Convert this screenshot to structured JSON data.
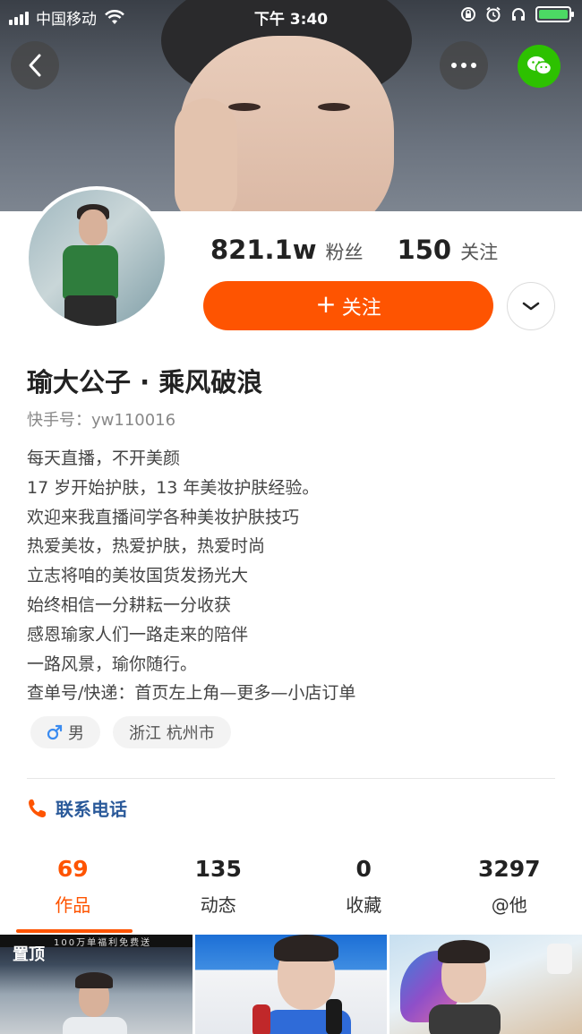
{
  "status_bar": {
    "carrier": "中国移动",
    "time": "下午 3:40"
  },
  "header": {
    "back_icon": "chevron-left-icon",
    "more_icon": "more-dots-icon",
    "share_icon": "wechat-icon"
  },
  "profile": {
    "followers_count": "821.1w",
    "followers_label": "粉丝",
    "following_count": "150",
    "following_label": "关注",
    "follow_button_label": "关注",
    "name": "瑜大公子 · 乘风破浪",
    "kuaishou_id": "快手号：yw110016",
    "bio_lines": [
      "每天直播，不开美颜",
      "17 岁开始护肤，13 年美妆护肤经验。",
      "欢迎来我直播间学各种美妆护肤技巧",
      "热爱美妆，热爱护肤，热爱时尚",
      "立志将咱的美妆国货发扬光大",
      "始终相信一分耕耘一分收获",
      "感恩瑜家人们一路走来的陪伴",
      "一路风景，瑜你随行。",
      "查单号/快递：首页左上角—更多—小店订单"
    ],
    "tags": {
      "gender": "男",
      "location": "浙江 杭州市"
    },
    "contact_label": "联系电话"
  },
  "tabs": [
    {
      "count": "69",
      "label": "作品"
    },
    {
      "count": "135",
      "label": "动态"
    },
    {
      "count": "0",
      "label": "收藏"
    },
    {
      "count": "3297",
      "label": "@他"
    }
  ],
  "grid": {
    "pinned_label": "置顶",
    "ribbon_text": "100万单福利免费送"
  },
  "colors": {
    "accent": "#fe5401",
    "contact_text": "#2b5a9a",
    "wechat": "#2dc100"
  }
}
